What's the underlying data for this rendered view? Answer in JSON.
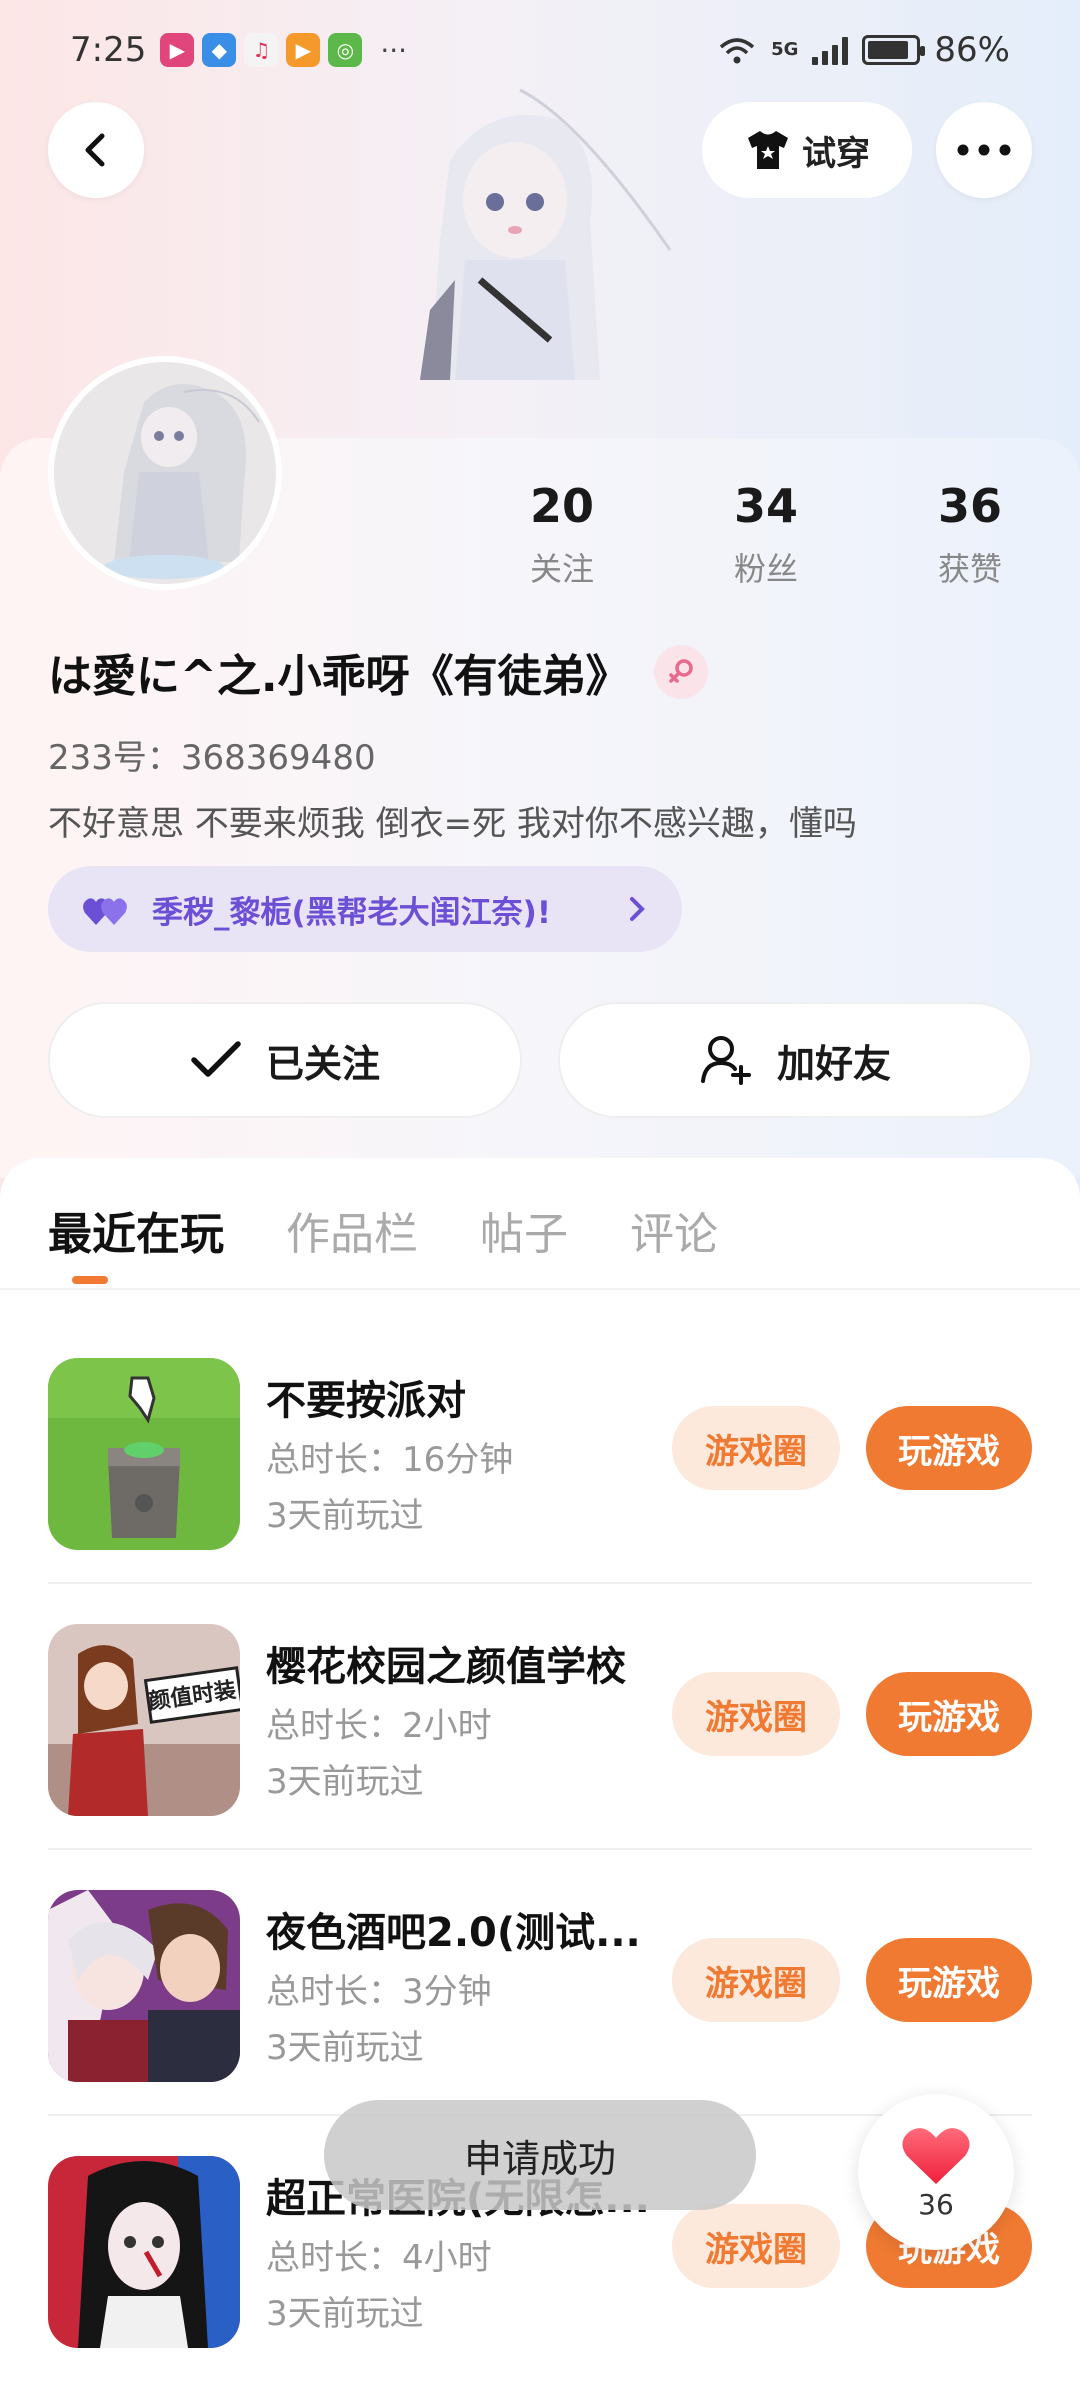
{
  "status_bar": {
    "time": "7:25",
    "network": "5G",
    "battery": "86%",
    "battery_level": 0.86
  },
  "header": {
    "tryon_label": "试穿"
  },
  "profile": {
    "stats": [
      {
        "value": "20",
        "label": "关注"
      },
      {
        "value": "34",
        "label": "粉丝"
      },
      {
        "value": "36",
        "label": "获赞"
      }
    ],
    "username": "は愛に^之.小乖呀《有徒弟》",
    "uid": "233号：368369480",
    "bio": "不好意思 不要来烦我  倒衣=死  我对你不感兴趣，懂吗",
    "guild": "季秽_黎栀(黑帮老大闺江奈)!",
    "follow_label": "已关注",
    "add_friend_label": "加好友"
  },
  "tabs": [
    "最近在玩",
    "作品栏",
    "帖子",
    "评论"
  ],
  "games": [
    {
      "title": "不要按派对",
      "duration": "总时长：16分钟",
      "last_played": "3天前玩过",
      "circle_label": "游戏圈",
      "play_label": "玩游戏"
    },
    {
      "title": "樱花校园之颜值学校",
      "duration": "总时长：2小时",
      "last_played": "3天前玩过",
      "circle_label": "游戏圈",
      "play_label": "玩游戏"
    },
    {
      "title": "夜色酒吧2.0(测试...",
      "duration": "总时长：3分钟",
      "last_played": "3天前玩过",
      "circle_label": "游戏圈",
      "play_label": "玩游戏"
    },
    {
      "title": "超正常医院(无限怎...",
      "duration": "总时长：4小时",
      "last_played": "3天前玩过",
      "circle_label": "游戏圈",
      "play_label": "玩游戏"
    }
  ],
  "game_icon_texts": {
    "game2_sign": "颜值时装"
  },
  "toast": "申请成功",
  "like": {
    "count": "36"
  },
  "colors": {
    "accent": "#f07a32",
    "accent_light": "#fde8dc",
    "guild_purple": "#6b4fd4"
  }
}
